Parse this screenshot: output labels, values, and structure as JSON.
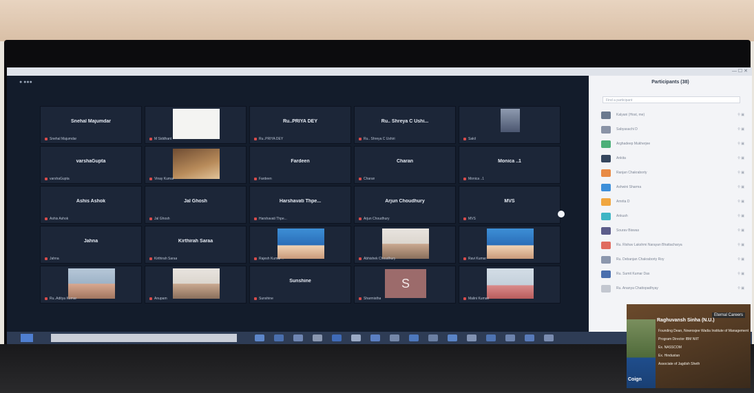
{
  "meeting": {
    "title_bar": "",
    "grid": [
      {
        "name": "Snehal Majumdar",
        "label": "Snehal Majumdar",
        "thumb": ""
      },
      {
        "name": "",
        "label": "M Siddhant",
        "thumb": "white"
      },
      {
        "name": "Ru..PRIYA DEY",
        "label": "Ru..PRIYA DEY",
        "thumb": ""
      },
      {
        "name": "Ru.. Shreya C Ushi...",
        "label": "Ru.. Shreya C Ushiri",
        "thumb": ""
      },
      {
        "name": "",
        "label": "Sakil",
        "thumb": "small"
      },
      {
        "name": "varshaGupta",
        "label": "varshaGupta",
        "thumb": ""
      },
      {
        "name": "",
        "label": "Vinay Kumar",
        "thumb": "room"
      },
      {
        "name": "Fardeen",
        "label": "Fardeen",
        "thumb": ""
      },
      {
        "name": "Charan",
        "label": "Charan",
        "thumb": ""
      },
      {
        "name": "Monica ..1",
        "label": "Monica ..1",
        "thumb": ""
      },
      {
        "name": "Ashis Ashok",
        "label": "Ashis Ashok",
        "thumb": ""
      },
      {
        "name": "Jal Ghosh",
        "label": "Jal Ghosh",
        "thumb": ""
      },
      {
        "name": "Harshavati Thpe...",
        "label": "Harshavati Thpe...",
        "thumb": ""
      },
      {
        "name": "Arjun Choudhury",
        "label": "Arjun Choudhury",
        "thumb": ""
      },
      {
        "name": "MVS",
        "label": "MVS",
        "thumb": ""
      },
      {
        "name": "Jahna",
        "label": "Jahna",
        "thumb": ""
      },
      {
        "name": "Kirthirah Saraa",
        "label": "Kirthirah Saraa",
        "thumb": ""
      },
      {
        "name": "",
        "label": "Rajesh Kumar ..",
        "thumb": "blue"
      },
      {
        "name": "",
        "label": "Abhishek Choudhury",
        "thumb": "light"
      },
      {
        "name": "",
        "label": "Ravi Kumar",
        "thumb": "blue"
      },
      {
        "name": "",
        "label": "Ru..Aditya Kumar",
        "thumb": "warm"
      },
      {
        "name": "",
        "label": "Anupam",
        "thumb": "light"
      },
      {
        "name": "Sunshine",
        "label": "Sunshine",
        "thumb": ""
      },
      {
        "name": "",
        "label": "Sharmistha",
        "thumb": "letter",
        "letter": "S"
      },
      {
        "name": "",
        "label": "Malini Kumari",
        "thumb": "pink"
      }
    ]
  },
  "participants": {
    "title": "Participants (38)",
    "search_placeholder": "Find a participant",
    "rows": [
      {
        "name": "Kalyani (Host, me)",
        "color": "#6b7a8f"
      },
      {
        "name": "Sabyasachi D",
        "color": "#8a93a6"
      },
      {
        "name": "Arghadeep Mukherjee",
        "color": "#4caf79"
      },
      {
        "name": "Ankita",
        "color": "#35465e"
      },
      {
        "name": "Ranjan Chakraborty",
        "color": "#e88a45"
      },
      {
        "name": "Ashwini Sharma",
        "color": "#3e8fd9"
      },
      {
        "name": "Amrita D",
        "color": "#f0a640"
      },
      {
        "name": "Ankush",
        "color": "#3fb5c4"
      },
      {
        "name": "Sourav Biswas",
        "color": "#5c5c8a"
      },
      {
        "name": "Ru. Rishav Lakshmi Narayan Bhattacharya",
        "color": "#e06b5f"
      },
      {
        "name": "Ru. Debanjan Chakraborty Roy",
        "color": "#8c97ad"
      },
      {
        "name": "Ru. Sumit Kumar Das",
        "color": "#4a6fae"
      },
      {
        "name": "Ru. Ananya Chattopadhyay",
        "color": "#c3c7d0"
      }
    ]
  },
  "pip": {
    "brand": "Eternal Careers",
    "header": "Raghuvansh Sinha (N.U.)",
    "lines": [
      "Founding Dean, Nowrosjee Wadia Institute of Management",
      "Program Director IBM NIIT",
      "Ex. NASSCOM",
      "Ex. Hindustan",
      "Associate of Jagdish Sheth"
    ],
    "logo": "Coign"
  },
  "colors": {
    "meeting_bg": "#131c2b",
    "tile_bg": "#1c2638",
    "panel_bg": "#f3f4f7",
    "taskbar": "#2e3c55"
  }
}
